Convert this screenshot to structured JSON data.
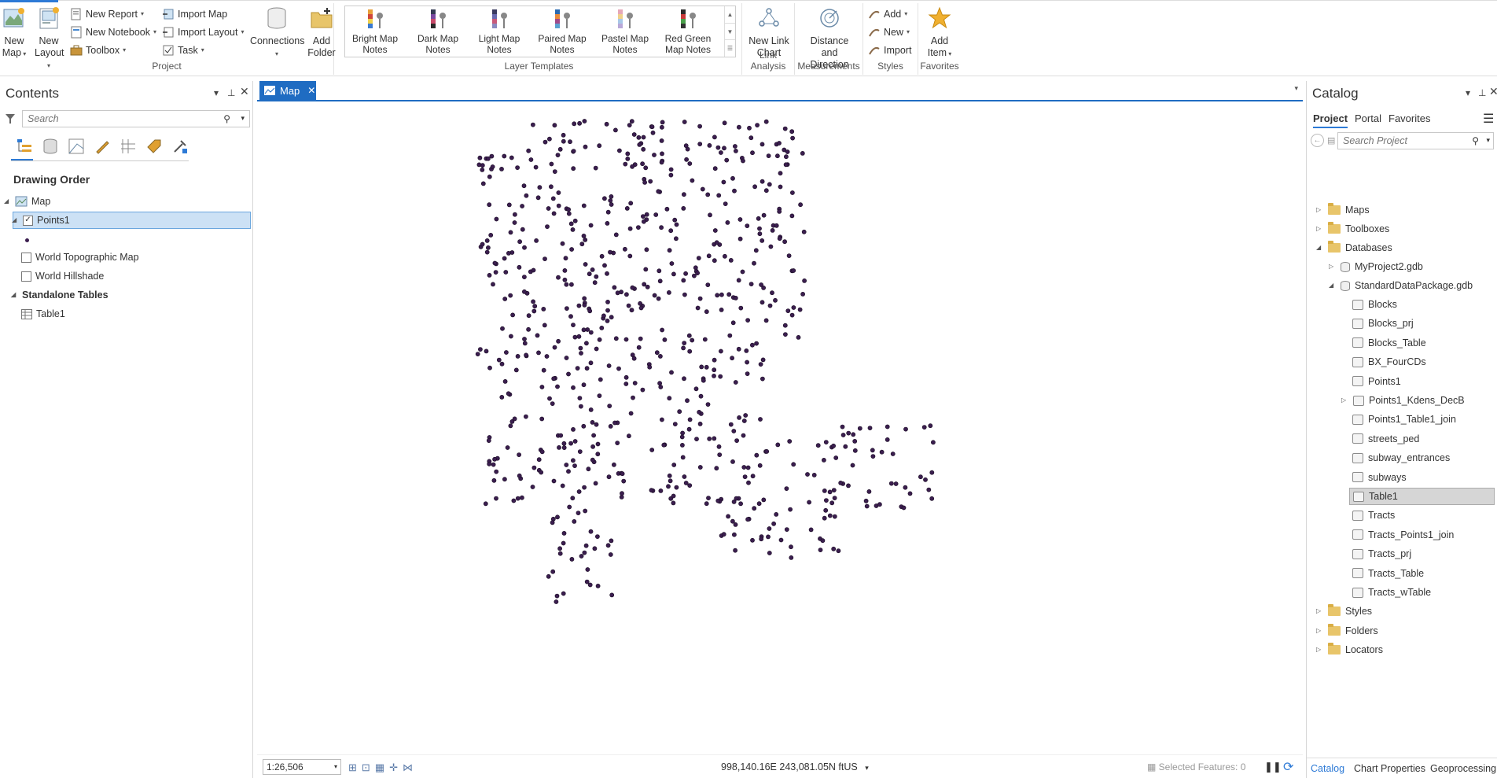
{
  "ribbon": {
    "new_map": "New Map",
    "new_layout": "New Layout",
    "new_report": "New Report",
    "new_notebook": "New Notebook",
    "toolbox": "Toolbox",
    "import_map": "Import Map",
    "import_layout": "Import Layout",
    "task": "Task",
    "connections": "Connections",
    "add_folder": "Add Folder",
    "project_group": "Project",
    "templates": [
      {
        "label": "Bright Map Notes",
        "colors": [
          "#e8a03a",
          "#d0473a",
          "#f0d048",
          "#3a7ad0"
        ]
      },
      {
        "label": "Dark Map Notes",
        "colors": [
          "#333a52",
          "#7a4aa0",
          "#c84a6a",
          "#2a2a2a"
        ]
      },
      {
        "label": "Light Map Notes",
        "colors": [
          "#3a3a60",
          "#6a6ab0",
          "#c85a7a",
          "#8a8ac0"
        ]
      },
      {
        "label": "Paired Map Notes",
        "colors": [
          "#2a6ab0",
          "#e88a3a",
          "#a04a8a",
          "#5aa0d0"
        ]
      },
      {
        "label": "Pastel Map Notes",
        "colors": [
          "#e6a8b8",
          "#f0d08a",
          "#a8c8e8",
          "#b8a8d8"
        ]
      },
      {
        "label": "Red Green Map Notes",
        "colors": [
          "#2a2a2a",
          "#c83a3a",
          "#4aa04a",
          "#333"
        ]
      }
    ],
    "layer_templates_group": "Layer Templates",
    "new_link_chart": "New Link Chart",
    "link_analysis_group": "Link Analysis",
    "distance_direction": "Distance and Direction",
    "measurements_group": "Measurements",
    "styles_add": "Add",
    "styles_new": "New",
    "styles_import": "Import",
    "styles_group": "Styles",
    "add_item": "Add Item",
    "favorites_group": "Favorites"
  },
  "contents": {
    "title": "Contents",
    "search_placeholder": "Search",
    "drawing_order": "Drawing Order",
    "map_label": "Map",
    "layer_points": "Points1",
    "layer_topo": "World Topographic Map",
    "layer_hillshade": "World Hillshade",
    "standalone_tables": "Standalone Tables",
    "table1": "Table1"
  },
  "map": {
    "tab_label": "Map",
    "scale": "1:26,506",
    "coordinates": "998,140.16E 243,081.05N ftUS",
    "selected_features": "Selected Features: 0",
    "point_color": "#3b1e4f"
  },
  "catalog": {
    "title": "Catalog",
    "tab_project": "Project",
    "tab_portal": "Portal",
    "tab_favorites": "Favorites",
    "search_placeholder": "Search Project",
    "maps": "Maps",
    "toolboxes": "Toolboxes",
    "databases": "Databases",
    "gdb1": "MyProject2.gdb",
    "gdb2": "StandardDataPackage.gdb",
    "items": [
      "Blocks",
      "Blocks_prj",
      "Blocks_Table",
      "BX_FourCDs",
      "Points1",
      "Points1_Kdens_DecB",
      "Points1_Table1_join",
      "streets_ped",
      "subway_entrances",
      "subways",
      "Table1",
      "Tracts",
      "Tracts_Points1_join",
      "Tracts_prj",
      "Tracts_Table",
      "Tracts_wTable"
    ],
    "styles": "Styles",
    "folders": "Folders",
    "locators": "Locators",
    "bottom_catalog": "Catalog",
    "bottom_chart": "Chart Properties",
    "bottom_geo": "Geoprocessing"
  }
}
